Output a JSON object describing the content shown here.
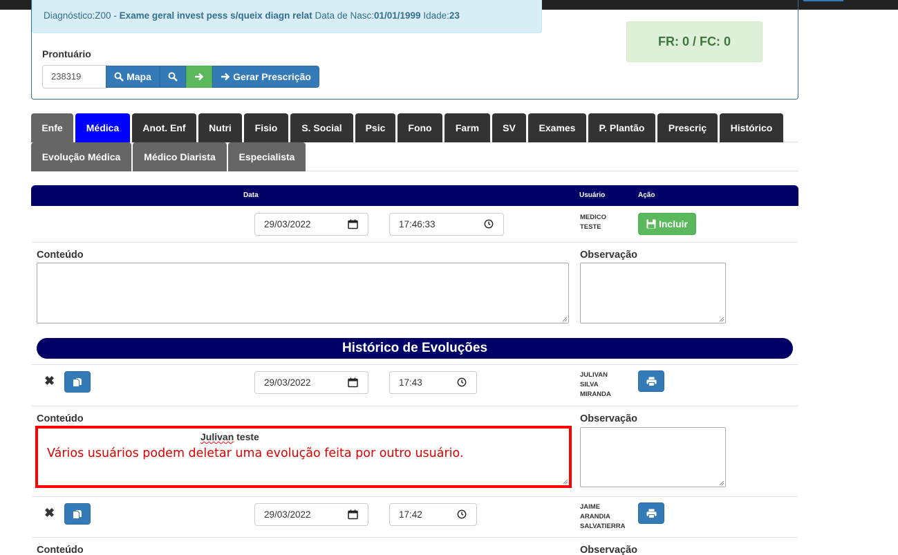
{
  "patient": {
    "diagnosis_label": "Diagnóstico:",
    "diagnosis_code": "Z00",
    "diagnosis_separator": " - ",
    "diagnosis_desc": "Exame geral invest pess s/queix diagn relat",
    "birth_label": " Data de Nasc:",
    "birth_date": "01/01/1999",
    "age_label": " Idade:",
    "age": "23",
    "vitals": "FR: 0 / FC: 0"
  },
  "prontuario": {
    "label": "Prontuário",
    "value": "238319",
    "mapa_label": "Mapa",
    "gerar_label": "Gerar Prescrição"
  },
  "tabs_row1": [
    "Enfe",
    "Médica",
    "Anot. Enf",
    "Nutri",
    "Fisio",
    "S. Social",
    "Psic",
    "Fono",
    "Farm",
    "SV",
    "Exames",
    "P. Plantão",
    "Prescriç",
    "Histórico"
  ],
  "tabs_row2": [
    "Evolução Médica",
    "Médico Diarista",
    "Especialista"
  ],
  "table_header": {
    "data": "Data",
    "usuario": "Usuário",
    "acao": "Ação"
  },
  "new_entry": {
    "date": "29/03/2022",
    "time": "17:46:33",
    "user_line1": "MEDICO",
    "user_line2": "TESTE",
    "incluir_label": "Incluir",
    "conteudo_label": "Conteúdo",
    "observacao_label": "Observação"
  },
  "history_title": "Histórico de Evoluções",
  "history": [
    {
      "date": "29/03/2022",
      "time": "17:43",
      "user_lines": [
        "JULIVAN",
        "SILVA",
        "MIRANDA"
      ],
      "conteudo_label": "Conteúdo",
      "observacao_label": "Observação",
      "content_word1": "Julivan",
      "content_word2": " teste",
      "annotation": "Vários usuários podem deletar uma evolução feita por outro usuário."
    },
    {
      "date": "29/03/2022",
      "time": "17:42",
      "user_lines": [
        "JAIME",
        "ARANDIA",
        "SALVATIERRA"
      ],
      "conteudo_label": "Conteúdo",
      "observacao_label": "Observação"
    }
  ],
  "colors": {
    "navy": "#000066",
    "active_tab": "#0000ff",
    "tab_dark": "#333333",
    "tab_gray": "#666666",
    "primary": "#337ab7",
    "success": "#5cb85c",
    "highlight": "#ff0000"
  }
}
